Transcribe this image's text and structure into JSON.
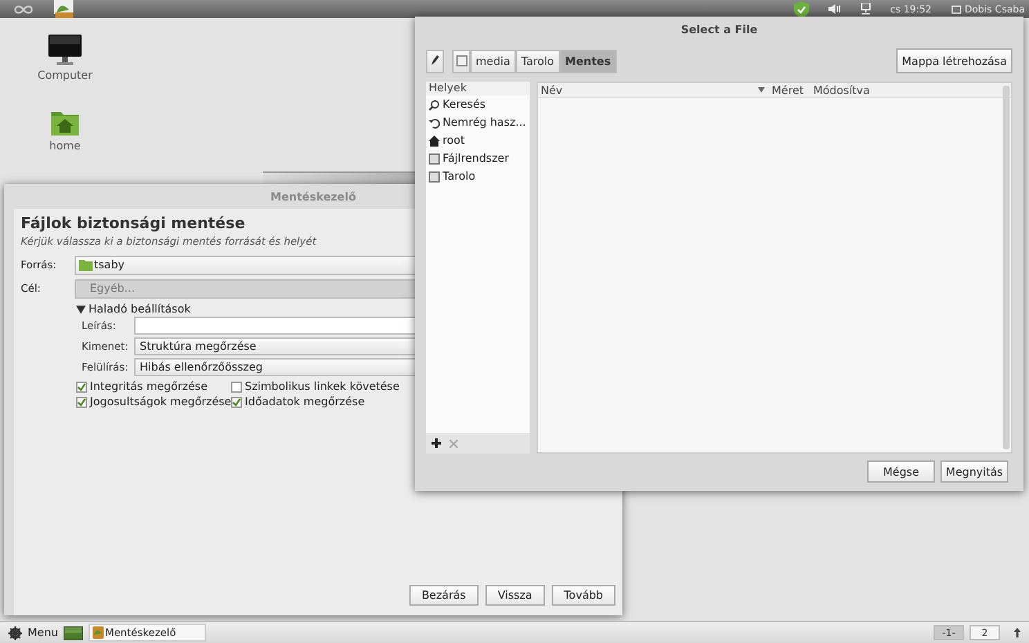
{
  "top_panel": {
    "clock": "cs 19:52",
    "user": "Dobis Csaba"
  },
  "desktop_icons": [
    {
      "label": "Computer",
      "kind": "computer"
    },
    {
      "label": "home",
      "kind": "folder"
    }
  ],
  "backup_window": {
    "title": "Mentéskezelő",
    "heading": "Fájlok biztonsági mentése",
    "subtitle": "Kérjük válassza ki a biztonsági mentés forrását és helyét",
    "source": {
      "label": "Forrás:",
      "value": "tsaby"
    },
    "target": {
      "label": "Cél:",
      "value": "Egyéb...",
      "disabled": true
    },
    "advanced": {
      "label": "Haladó beállítások",
      "expanded": true
    },
    "fields": [
      {
        "label": "Leírás:",
        "kind": "entry"
      },
      {
        "label": "Kimenet:",
        "kind": "combo",
        "value": "Struktúra megőrzése"
      },
      {
        "label": "Felülírás:",
        "kind": "combo",
        "value": "Hibás ellenőrzőösszeg"
      }
    ],
    "options": [
      {
        "label": "Integritás megőrzése",
        "checked": true
      },
      {
        "label": "Szimbolikus linkek követése",
        "checked": false
      },
      {
        "label": "Jogosultságok megőrzése",
        "checked": true
      },
      {
        "label": "Időadatok megőrzése",
        "checked": true
      }
    ],
    "buttons": [
      "Bezárás",
      "Vissza",
      "Tovább"
    ]
  },
  "file_dialog": {
    "title": "Select a File",
    "path": [
      {
        "label": "media",
        "selected": false
      },
      {
        "label": "Tarolo",
        "selected": false
      },
      {
        "label": "Mentes",
        "selected": true
      }
    ],
    "create_folder": "Mappa létrehozása",
    "places_header": "Helyek",
    "places": [
      {
        "label": "Keresés",
        "kind": "search"
      },
      {
        "label": "Nemrég hasz...",
        "kind": "recent"
      },
      {
        "label": "root",
        "kind": "home"
      },
      {
        "label": "Fájlrendszer",
        "kind": "drive"
      },
      {
        "label": "Tarolo",
        "kind": "drive"
      }
    ],
    "columns": [
      "Név",
      "Méret",
      "Módosítva"
    ],
    "buttons": [
      "Mégse",
      "Megnyitás"
    ]
  },
  "taskbar": {
    "menu": "Menu",
    "task": "Mentéskezelő",
    "workspaces": [
      {
        "label": "-1-",
        "selected": true
      },
      {
        "label": "2",
        "selected": false
      }
    ]
  }
}
